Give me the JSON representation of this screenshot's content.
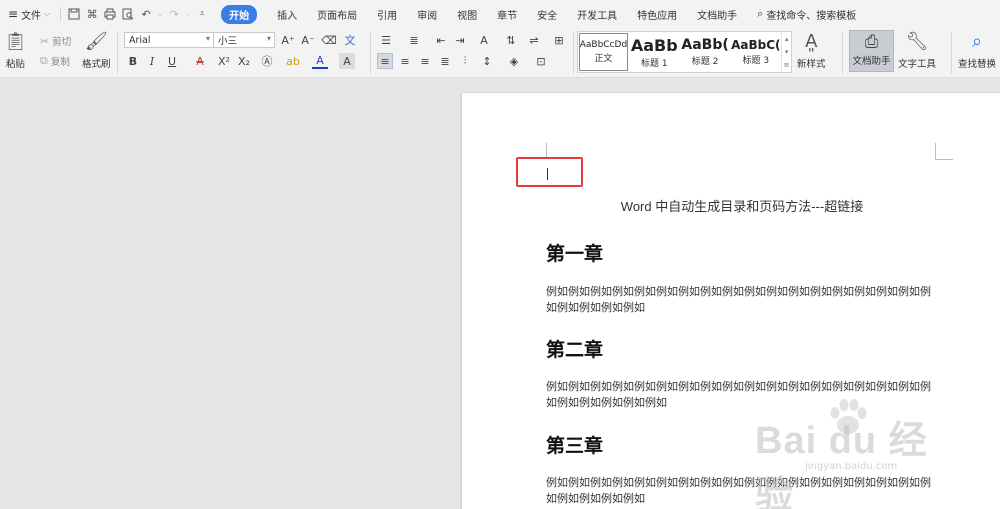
{
  "menubar": {
    "file_label": "文件",
    "tabs": [
      "开始",
      "插入",
      "页面布局",
      "引用",
      "审阅",
      "视图",
      "章节",
      "安全",
      "开发工具",
      "特色应用",
      "文档助手"
    ],
    "active_tab": "开始",
    "search_text": "查找命令、搜索模板"
  },
  "ribbon": {
    "paste_label": "粘贴",
    "cut_label": "剪切",
    "copy_label": "复制",
    "format_painter_label": "格式刷",
    "font_name": "Arial",
    "font_size": "小三",
    "styles": [
      {
        "sample": "AaBbCcDd",
        "name": "正文"
      },
      {
        "sample": "AaBb",
        "name": "标题 1"
      },
      {
        "sample": "AaBb(",
        "name": "标题 2"
      },
      {
        "sample": "AaBbC(",
        "name": "标题 3"
      }
    ],
    "new_style_label": "新样式",
    "doc_helper_label": "文档助手",
    "text_tools_label": "文字工具",
    "find_replace_label": "查找替换"
  },
  "document": {
    "title": "Word 中自动生成目录和页码方法---超链接",
    "sections": [
      {
        "heading": "第一章",
        "body": "例如例如例如例如例如例如例如例如例如例如例如例如例如例如例如例如例如例如例如例如例如例如"
      },
      {
        "heading": "第二章",
        "body": "例如例如例如例如例如例如例如例如例如例如例如例如例如例如例如例如例如例如例如例如例如例如例如"
      },
      {
        "heading": "第三章",
        "body": "例如例如例如例如例如例如例如例如例如例如例如例如例如例如例如例如例如例如例如例如例如例如"
      }
    ]
  },
  "watermark": {
    "main": "Bai du 经验",
    "sub": "jingyan.baidu.com"
  },
  "colors": {
    "accent": "#3b7ce5",
    "highlight_box": "#e23b3b"
  }
}
